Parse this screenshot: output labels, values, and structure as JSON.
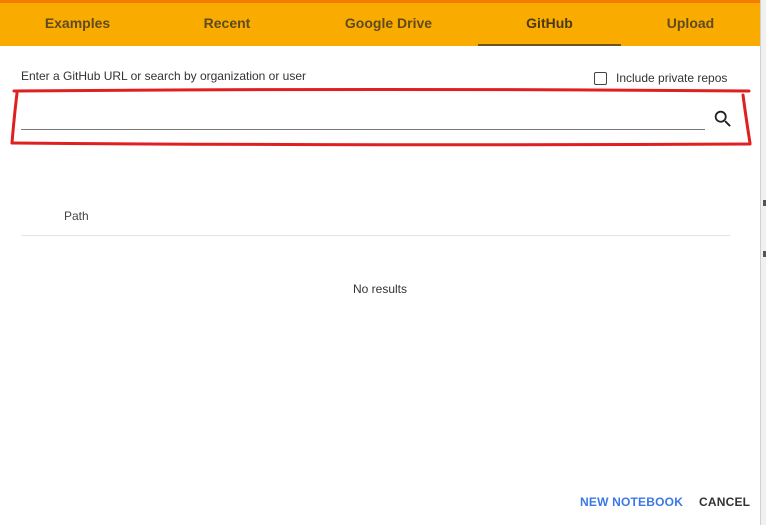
{
  "tabs": [
    {
      "label": "Examples",
      "active": false
    },
    {
      "label": "Recent",
      "active": false
    },
    {
      "label": "Google Drive",
      "active": false
    },
    {
      "label": "GitHub",
      "active": true
    },
    {
      "label": "Upload",
      "active": false
    }
  ],
  "github": {
    "hint": "Enter a GitHub URL or search by organization or user",
    "private_repos_label": "Include private repos",
    "private_repos_checked": false,
    "search_value": "",
    "search_icon": "search-icon"
  },
  "results": {
    "column_header": "Path",
    "empty_message": "No results"
  },
  "footer": {
    "new_notebook": "NEW NOTEBOOK",
    "cancel": "CANCEL"
  },
  "colors": {
    "tab_bar": "#f9ab00",
    "accent_top": "#f57c00",
    "annotation": "#e02020",
    "primary_link": "#3b78e7"
  }
}
